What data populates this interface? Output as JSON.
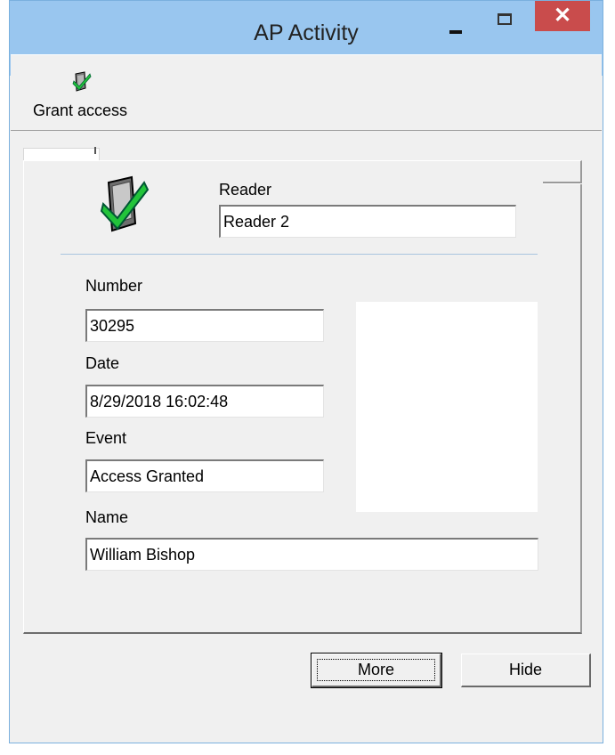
{
  "window": {
    "title": "AP Activity",
    "controls": {
      "minimize": "minimize",
      "maximize": "maximize",
      "close": "close"
    }
  },
  "toolbar": {
    "grant_access_label": "Grant access",
    "grant_access_icon": "reader-check-icon"
  },
  "reader": {
    "label": "Reader",
    "value": "Reader 2"
  },
  "number": {
    "label": "Number",
    "value": "30295"
  },
  "date": {
    "label": "Date",
    "value": "8/29/2018 16:02:48"
  },
  "event": {
    "label": "Event",
    "value": "Access Granted"
  },
  "name": {
    "label": "Name",
    "value": "William Bishop"
  },
  "buttons": {
    "more": "More",
    "hide": "Hide"
  },
  "colors": {
    "titlebar": "#99c6ef",
    "close_button": "#c94c4c",
    "check_green": "#22c43a",
    "divider": "#a9c5df"
  }
}
